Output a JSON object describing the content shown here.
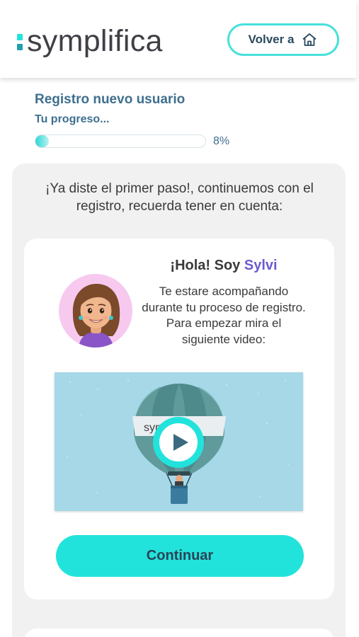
{
  "header": {
    "logo_text": "symplifica",
    "home_button_label": "Volver a",
    "home_icon": "home-icon"
  },
  "registration": {
    "title": "Registro nuevo usuario",
    "progress_label": "Tu progreso...",
    "progress_percent": 8,
    "progress_text": "8%"
  },
  "intro_text": "¡Ya diste el primer paso!, continuemos con el registro, recuerda tener en cuenta:",
  "assistant": {
    "greeting": "¡Hola! Soy",
    "name": "Sylvi",
    "description": "Te estare acompañando durante tu proceso de registro. Para empezar mira el siguiente video:",
    "avatar_icon": "sylvi-avatar"
  },
  "video": {
    "balloon_label": "symplifica",
    "play_icon": "play-icon"
  },
  "continue_button_label": "Continuar",
  "colors": {
    "accent": "#22e3dc",
    "accent_border": "#49e0dc",
    "heading_blue": "#3f6f8e",
    "name_purple": "#6b5bd0",
    "video_bg": "#a6d8e8",
    "logo_mark_top": "#22e3dc",
    "logo_mark_bottom": "#1f9fb0"
  }
}
